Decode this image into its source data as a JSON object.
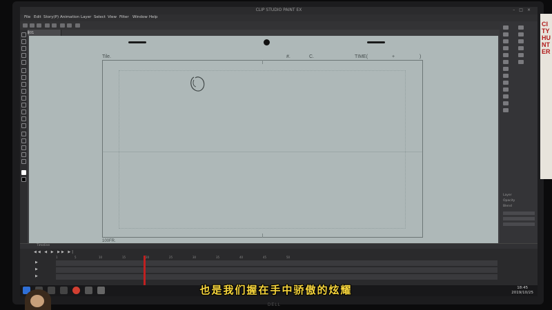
{
  "app": {
    "title": "CLIP STUDIO PAINT EX",
    "menus": [
      "File",
      "Edit",
      "Story(P)",
      "Animation",
      "Layer",
      "Select",
      "View",
      "Filter",
      "Window",
      "Help"
    ],
    "document_tab": "動畫01"
  },
  "canvas": {
    "header": {
      "title_label": "Tile.",
      "number_label": "#.",
      "cut_label": "C.",
      "time_label": "TIME(",
      "time_plus": "+",
      "time_close": ")"
    },
    "footer_label": "100FR."
  },
  "right_panel": {
    "labels": [
      "Layer",
      "Opacity",
      "Blend"
    ]
  },
  "timeline": {
    "title": "Timeline",
    "controls": "◀◀ ◀ ▶ ▶▶ ▶|",
    "ruler": [
      "1",
      "5",
      "10",
      "15",
      "20",
      "25",
      "30",
      "35",
      "40",
      "45",
      "50"
    ],
    "tracks": [
      "▶",
      "▶",
      "▶"
    ]
  },
  "taskbar": {
    "time": "18:45",
    "date": "2019/10/25"
  },
  "subtitle": "也是我们握在手中骄傲的炫耀",
  "monitor_brand": "DELL",
  "poster_text": "CITY HUNTER",
  "colors": {
    "subtitle": "#f7d53c",
    "paper": "#aeb8b8",
    "playhead": "#c02020",
    "ui_dark": "#2b2b2d"
  },
  "icons": [
    "close-icon",
    "minimize-icon",
    "maximize-icon",
    "windows-start-icon",
    "search-icon",
    "chrome-icon",
    "play-icon"
  ]
}
